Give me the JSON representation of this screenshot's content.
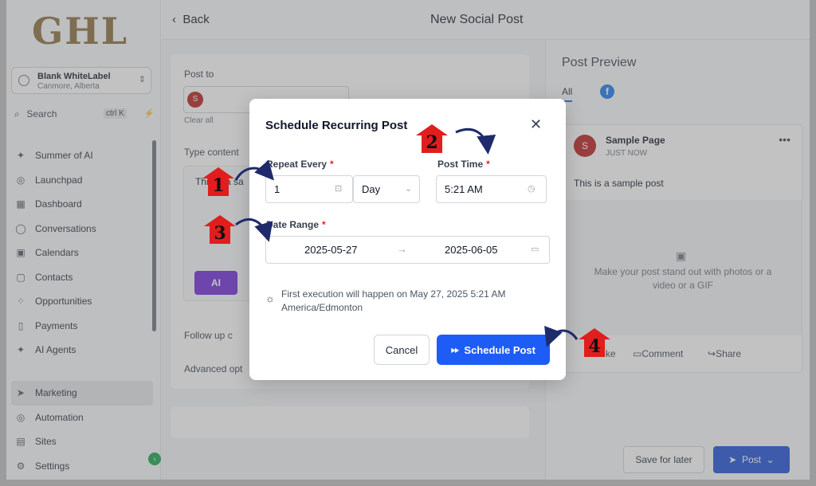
{
  "app": {
    "logo": "GHL",
    "account": {
      "name": "Blank WhiteLabel",
      "location": "Canmore, Alberta"
    },
    "search": {
      "label": "Search",
      "shortcut": "ctrl K"
    },
    "nav": [
      {
        "label": "Summer of AI",
        "icon": "sparkle-icon",
        "glyph": "✦"
      },
      {
        "label": "Launchpad",
        "icon": "rocket-icon",
        "glyph": "◎"
      },
      {
        "label": "Dashboard",
        "icon": "grid-icon",
        "glyph": "▦"
      },
      {
        "label": "Conversations",
        "icon": "chat-icon",
        "glyph": "◯"
      },
      {
        "label": "Calendars",
        "icon": "calendar-icon",
        "glyph": "▣"
      },
      {
        "label": "Contacts",
        "icon": "contacts-icon",
        "glyph": "▢"
      },
      {
        "label": "Opportunities",
        "icon": "opportunities-icon",
        "glyph": "⁘"
      },
      {
        "label": "Payments",
        "icon": "payments-icon",
        "glyph": "▯"
      },
      {
        "label": "AI Agents",
        "icon": "ai-agents-icon",
        "glyph": "✦"
      }
    ],
    "nav_bottom": [
      {
        "label": "Marketing",
        "icon": "send-icon",
        "glyph": "➤"
      },
      {
        "label": "Automation",
        "icon": "automation-icon",
        "glyph": "◎"
      },
      {
        "label": "Sites",
        "icon": "sites-icon",
        "glyph": "▤"
      },
      {
        "label": "Settings",
        "icon": "gear-icon",
        "glyph": "⚙"
      }
    ]
  },
  "header": {
    "back_label": "Back",
    "title": "New Social Post"
  },
  "form": {
    "post_to_label": "Post to",
    "clear_all": "Clear all",
    "avatar_letter": "S",
    "type_content_label": "Type content",
    "content_text": "This is a sa",
    "ai_label": "AI",
    "follow_up_label": "Follow up c",
    "advanced_label": "Advanced opt"
  },
  "preview": {
    "title": "Post Preview",
    "tab_all": "All",
    "page_name": "Sample Page",
    "page_time": "JUST NOW",
    "avatar_letter": "S",
    "post_text": "This is a sample post",
    "media_hint": "Make your post stand out with photos or a video or a GIF",
    "actions": {
      "like": "Like",
      "comment": "Comment",
      "share": "Share"
    }
  },
  "footer": {
    "save_later": "Save for later",
    "post": "Post"
  },
  "modal": {
    "title": "Schedule Recurring Post",
    "repeat_every_label": "Repeat Every",
    "repeat_value": "1",
    "repeat_unit": "Day",
    "post_time_label": "Post Time",
    "post_time_value": "5:21 AM",
    "date_range_label": "Date Range",
    "date_start": "2025-05-27",
    "date_end": "2025-06-05",
    "hint_line1": "First execution will happen on May 27, 2025 5:21 AM",
    "hint_line2": "America/Edmonton",
    "cancel": "Cancel",
    "schedule": "Schedule Post",
    "required_mark": "*"
  },
  "callouts": [
    "1",
    "2",
    "3",
    "4"
  ],
  "colors": {
    "primary": "#1d5cf5",
    "callout_red": "#e11d1d",
    "arrow_navy": "#1e2a6b",
    "ai_purple": "#6d28d9"
  }
}
